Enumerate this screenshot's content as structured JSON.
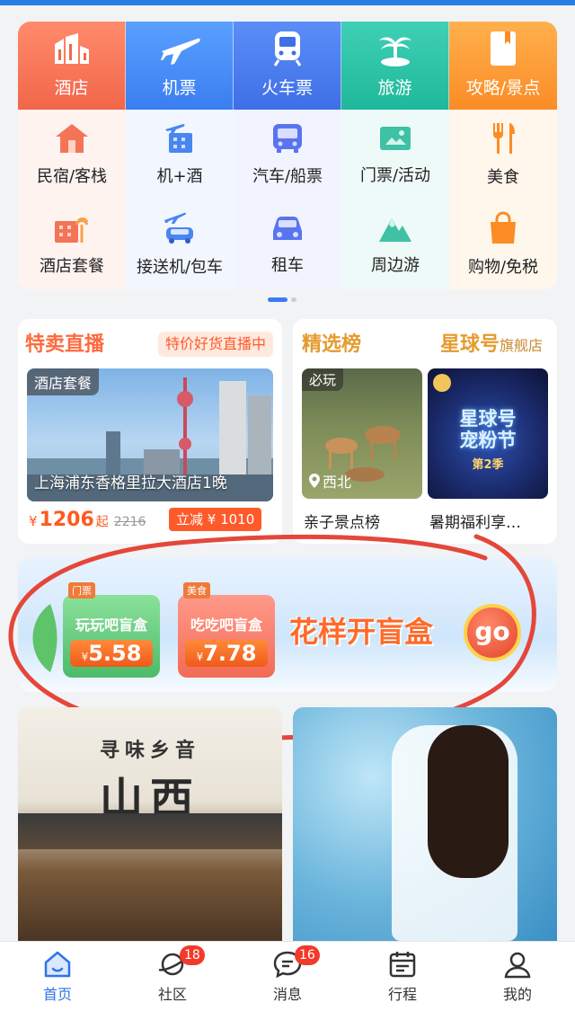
{
  "menu": {
    "top": [
      {
        "label": "酒店",
        "icon": "hotel-icon"
      },
      {
        "label": "机票",
        "icon": "airplane-icon"
      },
      {
        "label": "火车票",
        "icon": "train-icon"
      },
      {
        "label": "旅游",
        "icon": "palm-tree-icon"
      },
      {
        "label": "攻略/景点",
        "icon": "guide-book-icon"
      }
    ],
    "row2": [
      {
        "label": "民宿/客栈",
        "icon": "house-icon"
      },
      {
        "label": "机+酒",
        "icon": "flight-hotel-icon"
      },
      {
        "label": "汽车/船票",
        "icon": "bus-icon"
      },
      {
        "label": "门票/活动",
        "icon": "ticket-icon"
      },
      {
        "label": "美食",
        "icon": "fork-knife-icon"
      }
    ],
    "row3": [
      {
        "label": "酒店套餐",
        "icon": "hotel-package-icon"
      },
      {
        "label": "接送机/包车",
        "icon": "airport-transfer-icon"
      },
      {
        "label": "租车",
        "icon": "car-icon"
      },
      {
        "label": "周边游",
        "icon": "mountain-icon"
      },
      {
        "label": "购物/免税",
        "icon": "shopping-bag-icon"
      }
    ],
    "colors": {
      "hotel": "#f2664a",
      "flight": "#3a7ef0",
      "train": "#3e6fe6",
      "travel": "#1fb89b",
      "guide": "#fb8c26"
    }
  },
  "live": {
    "title": "特卖直播",
    "tag": "特价好货直播中",
    "badge": "酒店套餐",
    "caption": "上海浦东香格里拉大酒店1晚",
    "currency": "¥",
    "price": "1206",
    "price_suffix": "起",
    "original_price": "2216",
    "discount": "立减 ¥ 1010"
  },
  "rank": {
    "title": "精选榜",
    "brand": "星球号",
    "brand_suffix": "旗舰店",
    "item1_badge": "必玩",
    "item1_location": "西北",
    "item1_caption": "亲子景点榜",
    "item2_line1": "星球号",
    "item2_line2": "宠粉节",
    "item2_season": "第2季",
    "item2_caption": "暑期福利享…"
  },
  "banner": {
    "box1_tag": "门票",
    "box1_name": "玩玩吧盲盒",
    "box1_currency": "¥",
    "box1_price": "5.58",
    "box2_tag": "美食",
    "box2_name": "吃吃吧盲盒",
    "box2_currency": "¥",
    "box2_price": "7.78",
    "slogan": "花样开盲盒",
    "go": "go"
  },
  "feed": {
    "card1_prefix": "寻味乡音",
    "card1_city": "山西"
  },
  "tabs": [
    {
      "label": "首页",
      "icon": "home-icon",
      "badge": ""
    },
    {
      "label": "社区",
      "icon": "planet-icon",
      "badge": "18"
    },
    {
      "label": "消息",
      "icon": "chat-icon",
      "badge": "16"
    },
    {
      "label": "行程",
      "icon": "calendar-icon",
      "badge": ""
    },
    {
      "label": "我的",
      "icon": "user-icon",
      "badge": ""
    }
  ],
  "accent": "#2f73e8",
  "annotation_color": "#e4473a"
}
